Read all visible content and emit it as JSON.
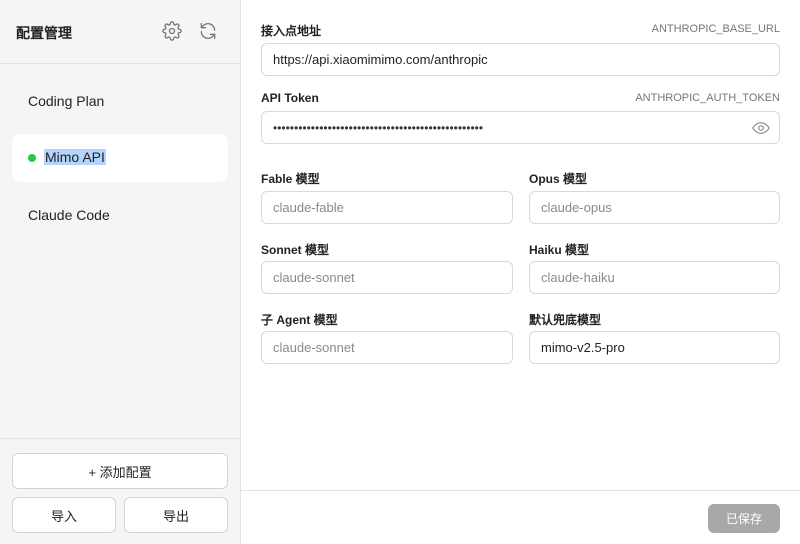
{
  "sidebar": {
    "title": "配置管理",
    "profiles": [
      {
        "label": "Coding Plan",
        "active": false
      },
      {
        "label": "Mimo API",
        "active": true
      },
      {
        "label": "Claude Code",
        "active": false
      }
    ],
    "add_label": "+ 添加配置",
    "import_label": "导入",
    "export_label": "导出"
  },
  "form": {
    "base_url": {
      "label": "接入点地址",
      "env": "ANTHROPIC_BASE_URL",
      "value": "https://api.xiaomimimo.com/anthropic"
    },
    "token": {
      "label": "API Token",
      "env": "ANTHROPIC_AUTH_TOKEN",
      "masked": "••••••••••••••••••••••••••••••••••••••••••••••••••"
    },
    "fable": {
      "label": "Fable 模型",
      "placeholder": "claude-fable"
    },
    "opus": {
      "label": "Opus 模型",
      "placeholder": "claude-opus"
    },
    "sonnet": {
      "label": "Sonnet 模型",
      "placeholder": "claude-sonnet"
    },
    "haiku": {
      "label": "Haiku 模型",
      "placeholder": "claude-haiku"
    },
    "subagent": {
      "label": "子 Agent 模型",
      "placeholder": "claude-sonnet"
    },
    "fallback": {
      "label": "默认兜底模型",
      "value": "mimo-v2.5-pro"
    }
  },
  "footer": {
    "save_label": "已保存"
  },
  "colors": {
    "active_dot": "#28c840",
    "save_disabled": "#a8a8a8",
    "selection": "#b3d4fc"
  }
}
